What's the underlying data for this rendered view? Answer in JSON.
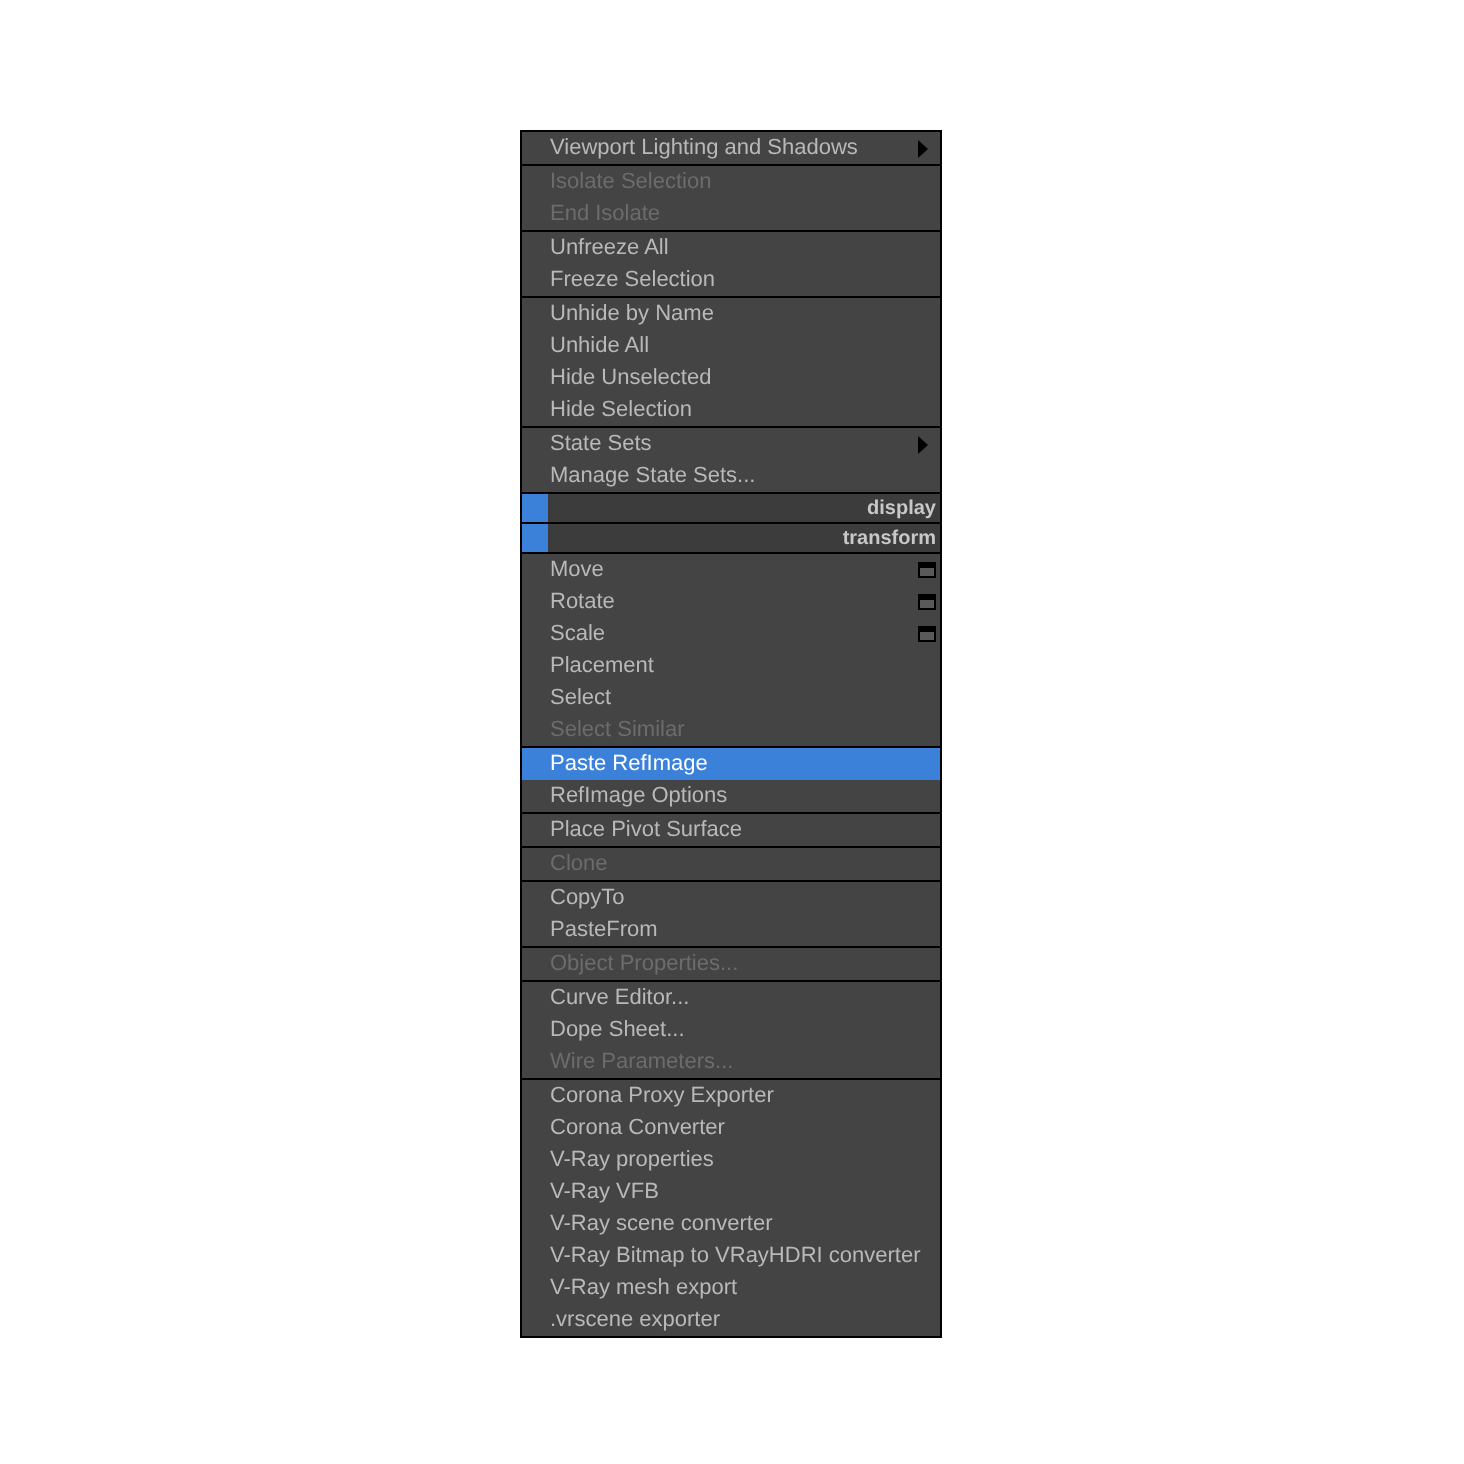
{
  "menu": {
    "sections": [
      {
        "kind": "group",
        "items": [
          {
            "label": "Viewport Lighting and Shadows",
            "kind": "submenu",
            "disabled": false,
            "selected": false
          }
        ]
      },
      {
        "kind": "group",
        "items": [
          {
            "label": "Isolate Selection",
            "kind": "plain",
            "disabled": true,
            "selected": false
          },
          {
            "label": "End Isolate",
            "kind": "plain",
            "disabled": true,
            "selected": false
          }
        ]
      },
      {
        "kind": "group",
        "items": [
          {
            "label": "Unfreeze All",
            "kind": "plain",
            "disabled": false,
            "selected": false
          },
          {
            "label": "Freeze Selection",
            "kind": "plain",
            "disabled": false,
            "selected": false
          }
        ]
      },
      {
        "kind": "group",
        "items": [
          {
            "label": "Unhide by Name",
            "kind": "plain",
            "disabled": false,
            "selected": false
          },
          {
            "label": "Unhide All",
            "kind": "plain",
            "disabled": false,
            "selected": false
          },
          {
            "label": "Hide Unselected",
            "kind": "plain",
            "disabled": false,
            "selected": false
          },
          {
            "label": "Hide Selection",
            "kind": "plain",
            "disabled": false,
            "selected": false
          }
        ]
      },
      {
        "kind": "group",
        "items": [
          {
            "label": "State Sets",
            "kind": "submenu",
            "disabled": false,
            "selected": false
          },
          {
            "label": "Manage State Sets...",
            "kind": "plain",
            "disabled": false,
            "selected": false
          }
        ]
      },
      {
        "kind": "header",
        "label": "display"
      },
      {
        "kind": "header",
        "label": "transform"
      },
      {
        "kind": "group",
        "items": [
          {
            "label": "Move",
            "kind": "option",
            "disabled": false,
            "selected": false
          },
          {
            "label": "Rotate",
            "kind": "option",
            "disabled": false,
            "selected": false
          },
          {
            "label": "Scale",
            "kind": "option",
            "disabled": false,
            "selected": false
          },
          {
            "label": "Placement",
            "kind": "plain",
            "disabled": false,
            "selected": false
          },
          {
            "label": "Select",
            "kind": "plain",
            "disabled": false,
            "selected": false
          },
          {
            "label": "Select Similar",
            "kind": "plain",
            "disabled": true,
            "selected": false
          }
        ]
      },
      {
        "kind": "group",
        "items": [
          {
            "label": "Paste RefImage",
            "kind": "plain",
            "disabled": false,
            "selected": true
          },
          {
            "label": "RefImage Options",
            "kind": "plain",
            "disabled": false,
            "selected": false
          }
        ]
      },
      {
        "kind": "group",
        "items": [
          {
            "label": "Place Pivot Surface",
            "kind": "plain",
            "disabled": false,
            "selected": false
          }
        ]
      },
      {
        "kind": "group",
        "items": [
          {
            "label": "Clone",
            "kind": "plain",
            "disabled": true,
            "selected": false
          }
        ]
      },
      {
        "kind": "group",
        "items": [
          {
            "label": "CopyTo",
            "kind": "plain",
            "disabled": false,
            "selected": false
          },
          {
            "label": "PasteFrom",
            "kind": "plain",
            "disabled": false,
            "selected": false
          }
        ]
      },
      {
        "kind": "group",
        "items": [
          {
            "label": "Object Properties...",
            "kind": "plain",
            "disabled": true,
            "selected": false
          }
        ]
      },
      {
        "kind": "group",
        "items": [
          {
            "label": "Curve Editor...",
            "kind": "plain",
            "disabled": false,
            "selected": false
          },
          {
            "label": "Dope Sheet...",
            "kind": "plain",
            "disabled": false,
            "selected": false
          },
          {
            "label": "Wire Parameters...",
            "kind": "plain",
            "disabled": true,
            "selected": false
          }
        ]
      },
      {
        "kind": "group",
        "items": [
          {
            "label": "Corona Proxy Exporter",
            "kind": "plain",
            "disabled": false,
            "selected": false
          },
          {
            "label": "Corona Converter",
            "kind": "plain",
            "disabled": false,
            "selected": false
          },
          {
            "label": "V-Ray properties",
            "kind": "plain",
            "disabled": false,
            "selected": false
          },
          {
            "label": "V-Ray VFB",
            "kind": "plain",
            "disabled": false,
            "selected": false
          },
          {
            "label": "V-Ray scene converter",
            "kind": "plain",
            "disabled": false,
            "selected": false
          },
          {
            "label": "V-Ray Bitmap to VRayHDRI converter",
            "kind": "plain",
            "disabled": false,
            "selected": false
          },
          {
            "label": "V-Ray mesh export",
            "kind": "plain",
            "disabled": false,
            "selected": false
          },
          {
            "label": ".vrscene exporter",
            "kind": "plain",
            "disabled": false,
            "selected": false
          }
        ]
      }
    ]
  }
}
